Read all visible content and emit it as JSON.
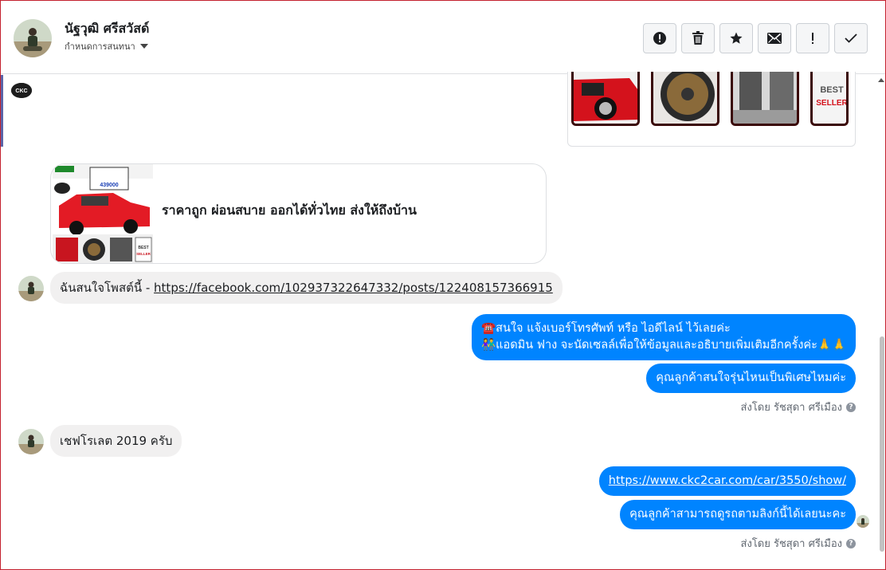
{
  "header": {
    "name": "นัฐวุฒิ ศรีสวัสด์",
    "subtitle": "กำหนดการสนทนา",
    "actions": [
      {
        "icon": "spam-icon",
        "glyph": "!"
      },
      {
        "icon": "trash-icon"
      },
      {
        "icon": "star-icon"
      },
      {
        "icon": "envelope-icon"
      },
      {
        "icon": "exclamation-icon",
        "glyph": "!"
      },
      {
        "icon": "check-icon"
      }
    ]
  },
  "link_card": {
    "title": "ราคาถูก ผ่อนสบาย ออกได้ทั่วไทย ส่งให้ถึงบ้าน",
    "thumb_price": "439000",
    "thumb_badge": "BEST SELLER"
  },
  "prev_card": {
    "badge": "BEST SELLER"
  },
  "messages": {
    "in1_prefix": "ฉันสนใจโพสต์นี้ - ",
    "in1_link": "https://facebook.com/102937322647332/posts/122408157366915",
    "out1_line1": "☎️สนใจ แจ้งเบอร์โทรศัพท์ หรือ ไอดีไลน์  ไว้เลยค่ะ",
    "out1_line2": "👫แอดมิน ฟาง จะนัดเซลล์เพื่อให้ข้อมูลและอธิบายเพิ่มเติมอีกครั้งค่ะ🙏🙏",
    "out2": "คุณลูกค้าสนใจรุ่นไหนเป็นพิเศษไหมค่ะ",
    "sent_by_1": "ส่งโดย รัชสุดา ศรีเมือง",
    "in2": "เชฟโรเลต   2019 ครับ",
    "out3_link": "https://www.ckc2car.com/car/3550/show/",
    "out4": "คุณลูกค้าสามารถดูรถตามลิงก์นี้ได้เลยนะคะ",
    "sent_by_2": "ส่งโดย รัชสุดา ศรีเมือง"
  },
  "colors": {
    "outgoing": "#0084ff",
    "incoming": "#f1f0f0",
    "accent_border": "#c4212e"
  }
}
